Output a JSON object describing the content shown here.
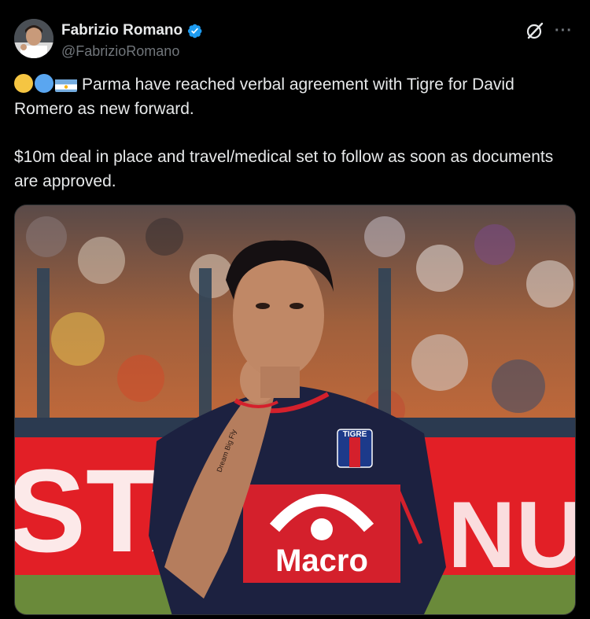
{
  "author": {
    "display_name": "Fabrizio Romano",
    "handle": "@FabrizioRomano",
    "verified": true,
    "verified_color": "#1d9bf0"
  },
  "tweet": {
    "emoji": [
      "yellow-circle",
      "blue-circle",
      "argentina-flag"
    ],
    "paragraph_1": "Parma have reached verbal agreement with Tigre for David Romero as new forward.",
    "paragraph_2": "$10m deal in place and travel/medical set to follow as soon as documents are approved."
  },
  "media": {
    "shirt_badge_text": "TIGRE",
    "sponsor_text": "Macro",
    "banner_left_text": "STAZ",
    "banner_right_text": "NUEVA",
    "tattoo_text": "Dream Big Fly"
  },
  "icons": {
    "grok": "grok-icon",
    "more": "more-icon"
  },
  "colors": {
    "background": "#000000",
    "text": "#e7e9ea",
    "secondary": "#71767b",
    "jersey_navy": "#1c2140",
    "jersey_red": "#d4202c",
    "banner_red": "#e21f26"
  }
}
